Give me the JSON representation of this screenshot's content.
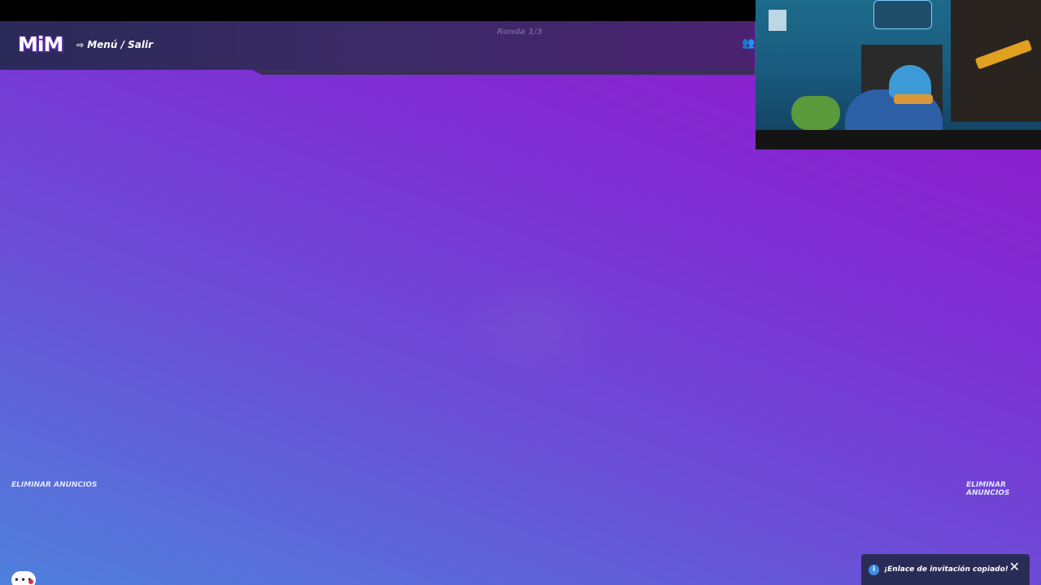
{
  "header": {
    "logo": "MiM",
    "menu_label": "Menú / Salir",
    "round_label": "Ronda 1/3"
  },
  "ads": {
    "left_label": "ELIMINAR ANUNCIOS",
    "right_label": "ELIMINAR ANUNCIOS"
  },
  "toast": {
    "message": "¡Enlace de invitación copiado!"
  },
  "icons": {
    "menu": "exit-icon",
    "players": "players-icon",
    "chat": "chat-icon",
    "info": "info-icon",
    "close": "close-icon"
  },
  "colors": {
    "accent_green": "#3cd25a",
    "toast_bg": "#2a2c58",
    "info_blue": "#3d8ee6"
  }
}
